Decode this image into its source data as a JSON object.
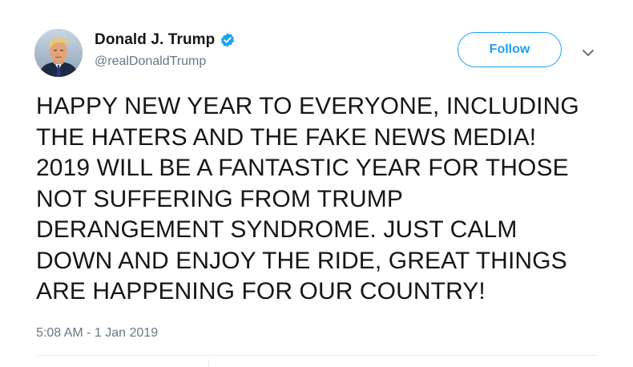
{
  "user": {
    "display_name": "Donald J. Trump",
    "handle": "@realDonaldTrump",
    "verified": true,
    "avatar_icon": "profile-photo"
  },
  "actions": {
    "follow_label": "Follow",
    "more_icon": "chevron-down-icon"
  },
  "tweet": {
    "text": "HAPPY NEW YEAR TO EVERYONE, INCLUDING\nTHE HATERS AND THE FAKE NEWS MEDIA!\n2019 WILL BE A FANTASTIC YEAR FOR THOSE\nNOT SUFFERING FROM TRUMP\nDERANGEMENT SYNDROME. JUST CALM\nDOWN AND ENJOY THE RIDE, GREAT THINGS\nARE HAPPENING FOR OUR COUNTRY!",
    "timestamp": "5:08 AM - 1 Jan 2019"
  },
  "colors": {
    "accent": "#1da1f2",
    "text": "#14171a",
    "secondary_text": "#657786",
    "divider": "#e6ecf0"
  }
}
